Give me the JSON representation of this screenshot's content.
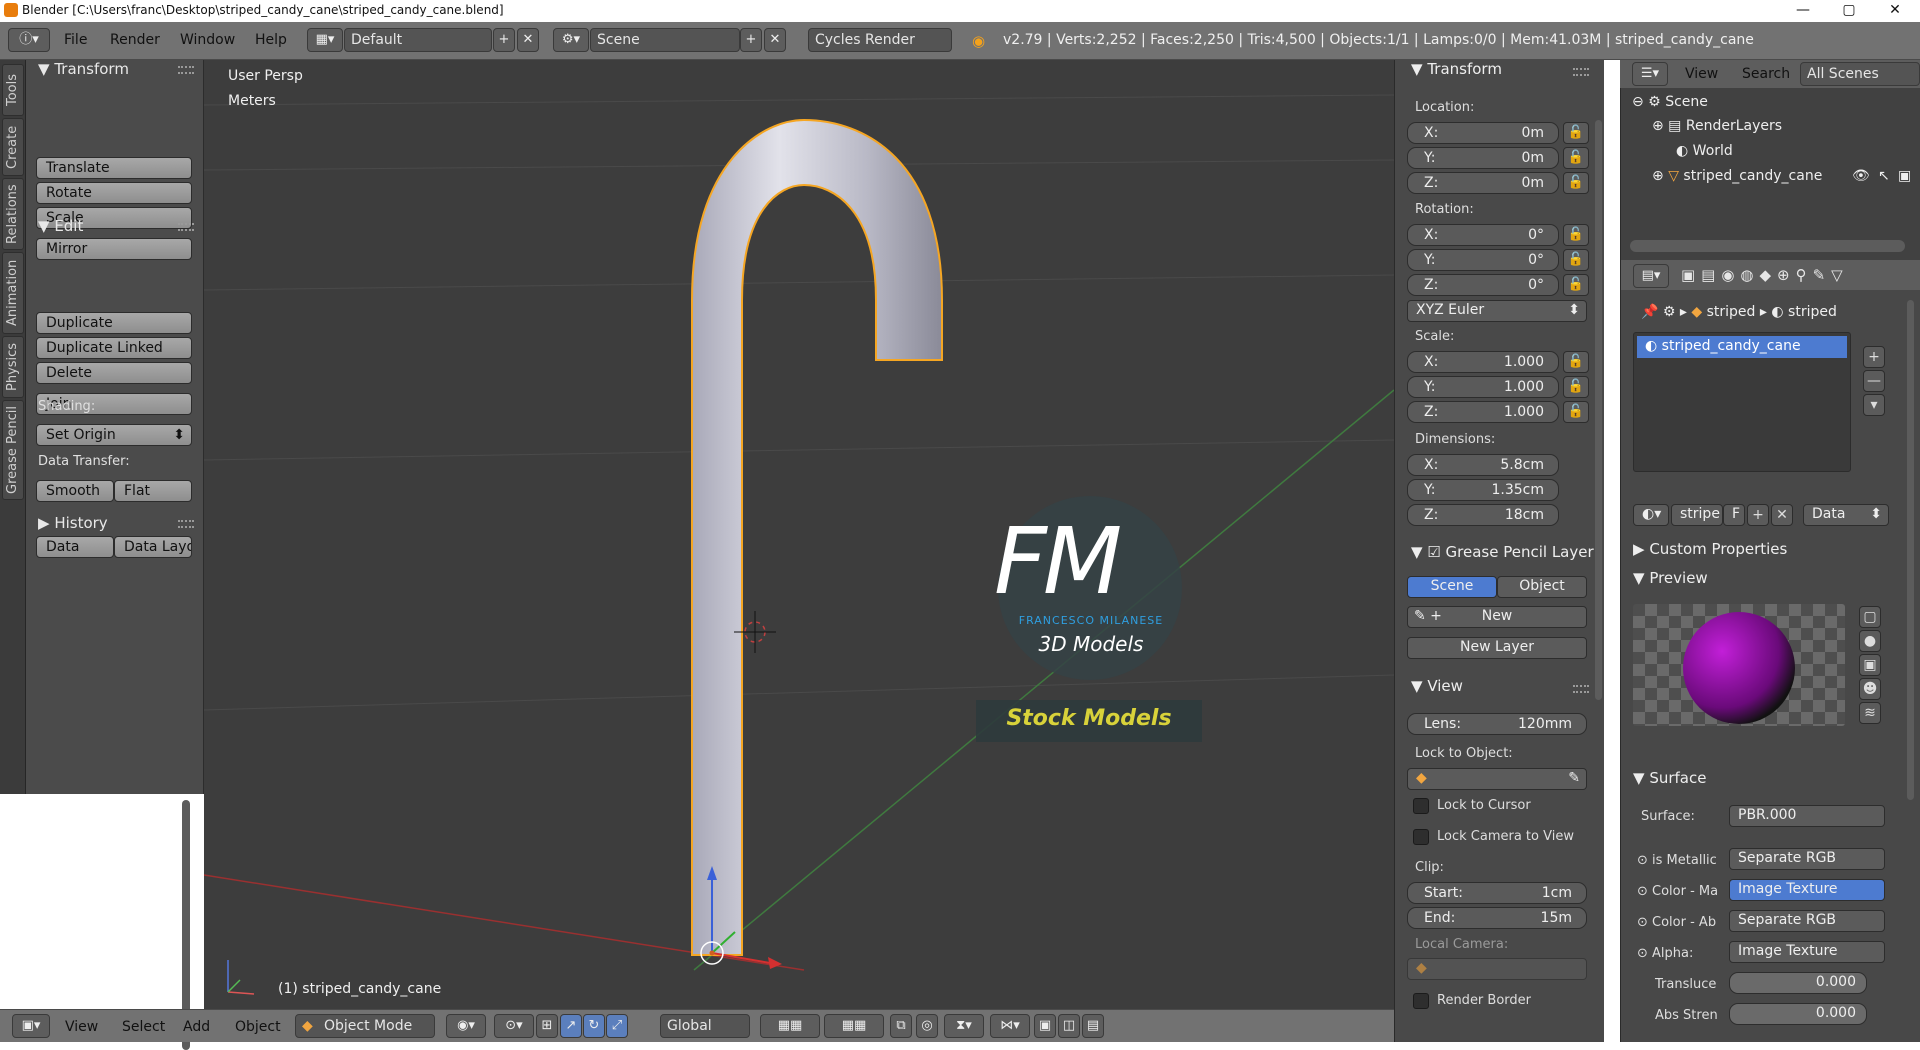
{
  "window": {
    "title": "Blender [C:\\Users\\franc\\Desktop\\striped_candy_cane\\striped_candy_cane.blend]",
    "minimize": "—",
    "maximize": "▢",
    "close": "✕"
  },
  "topbar": {
    "menus": [
      "File",
      "Render",
      "Window",
      "Help"
    ],
    "layout": "Default",
    "scene": "Scene",
    "engine": "Cycles Render",
    "stats": "v2.79 | Verts:2,252 | Faces:2,250 | Tris:4,500 | Objects:1/1 | Lamps:0/0 | Mem:41.03M | striped_candy_cane"
  },
  "tabs": [
    "Tools",
    "Create",
    "Relations",
    "Animation",
    "Physics",
    "Grease Pencil"
  ],
  "tools": {
    "transform_header": "Transform",
    "translate": "Translate",
    "rotate": "Rotate",
    "scale": "Scale",
    "mirror": "Mirror",
    "edit_header": "Edit",
    "duplicate": "Duplicate",
    "duplicate_linked": "Duplicate Linked",
    "delete": "Delete",
    "join": "Join",
    "set_origin": "Set Origin",
    "shading_label": "Shading:",
    "smooth": "Smooth",
    "flat": "Flat",
    "data_transfer_label": "Data Transfer:",
    "data": "Data",
    "data_layout": "Data Layo",
    "history_header": "History"
  },
  "viewport": {
    "view_name": "User Persp",
    "units": "Meters",
    "object_label": "(1) striped_candy_cane",
    "watermark_title": "FM",
    "watermark_name": "FRANCESCO MILANESE",
    "watermark_sub": "3D Models",
    "watermark_badge": "Stock Models"
  },
  "bottombar": {
    "menus": [
      "View",
      "Select",
      "Add",
      "Object"
    ],
    "mode": "Object Mode",
    "orientation": "Global"
  },
  "npanel": {
    "transform_header": "Transform",
    "location_label": "Location:",
    "location": [
      {
        "axis": "X:",
        "value": "0m"
      },
      {
        "axis": "Y:",
        "value": "0m"
      },
      {
        "axis": "Z:",
        "value": "0m"
      }
    ],
    "rotation_label": "Rotation:",
    "rotation": [
      {
        "axis": "X:",
        "value": "0°"
      },
      {
        "axis": "Y:",
        "value": "0°"
      },
      {
        "axis": "Z:",
        "value": "0°"
      }
    ],
    "rotation_mode": "XYZ Euler",
    "scale_label": "Scale:",
    "scale": [
      {
        "axis": "X:",
        "value": "1.000"
      },
      {
        "axis": "Y:",
        "value": "1.000"
      },
      {
        "axis": "Z:",
        "value": "1.000"
      }
    ],
    "dimensions_label": "Dimensions:",
    "dimensions": [
      {
        "axis": "X:",
        "value": "5.8cm"
      },
      {
        "axis": "Y:",
        "value": "1.35cm"
      },
      {
        "axis": "Z:",
        "value": "18cm"
      }
    ],
    "grease_header": "Grease Pencil Layer",
    "scene_btn": "Scene",
    "object_btn": "Object",
    "new_btn": "New",
    "new_layer_btn": "New Layer",
    "view_header": "View",
    "lens_label": "Lens:",
    "lens_value": "120mm",
    "lock_object_label": "Lock to Object:",
    "lock_cursor": "Lock to Cursor",
    "lock_camera": "Lock Camera to View",
    "clip_label": "Clip:",
    "clip_start_label": "Start:",
    "clip_start": "1cm",
    "clip_end_label": "End:",
    "clip_end": "15m",
    "local_camera_label": "Local Camera:",
    "render_border": "Render Border"
  },
  "outliner": {
    "view": "View",
    "search": "Search",
    "scenes": "All Scenes",
    "items": [
      "Scene",
      "RenderLayers",
      "World",
      "striped_candy_cane"
    ]
  },
  "properties": {
    "breadcrumb_1": "striped",
    "breadcrumb_2": "striped",
    "material_slot": "striped_candy_cane",
    "material_name": "stripe",
    "fake_user": "F",
    "link": "Data",
    "custom_props": "Custom Properties",
    "preview": "Preview",
    "surface_header": "Surface",
    "surface_label": "Surface:",
    "surface_value": "PBR.000",
    "inputs": [
      {
        "label": "is Metallic",
        "value": "Separate RGB"
      },
      {
        "label": "Color - Ma",
        "value": "Image Texture"
      },
      {
        "label": "Color - Ab",
        "value": "Separate RGB"
      },
      {
        "label": "Alpha:",
        "value": "Image Texture"
      }
    ],
    "translucency_label": "Translucе",
    "translucency": "0.000",
    "abs_label": "Abs Stren",
    "abs": "0.000"
  },
  "colors": {
    "selected": "#4d7bd0",
    "outline": "#f5a623",
    "watermark_blue": "#2f9fe0",
    "watermark_badge_text": "#d8d23a"
  }
}
